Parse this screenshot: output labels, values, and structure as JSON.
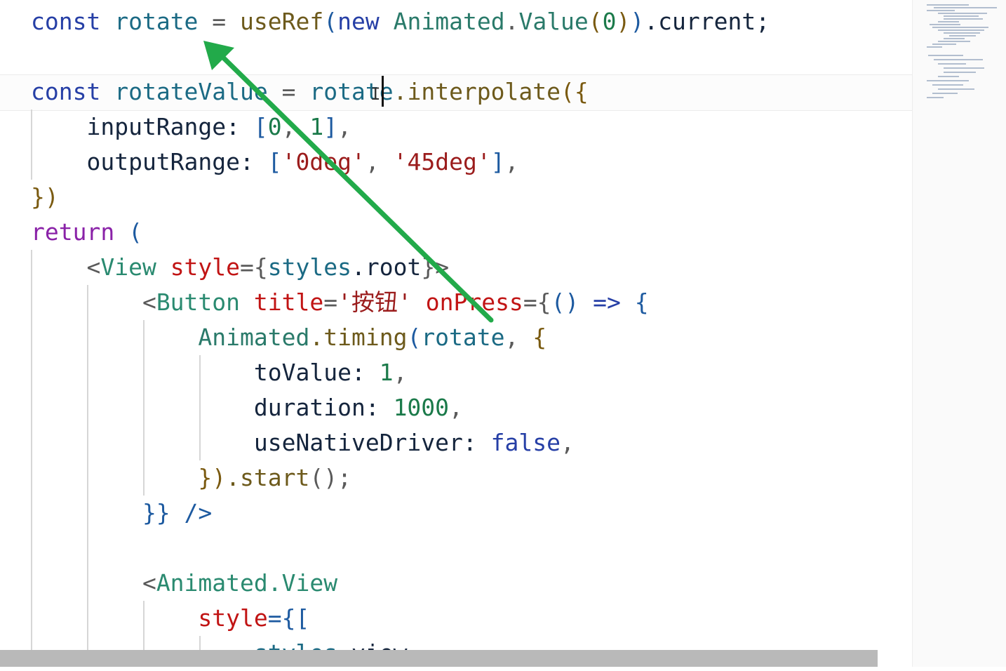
{
  "editor": {
    "lines": [
      [
        [
          "const ",
          "kw"
        ],
        [
          "rotate",
          "var"
        ],
        [
          " = ",
          "pun"
        ],
        [
          "useRef",
          "fn"
        ],
        [
          "(",
          "br1"
        ],
        [
          "new ",
          "kw"
        ],
        [
          "Animated",
          "cls"
        ],
        [
          ".",
          "pun"
        ],
        [
          "Value",
          "cls"
        ],
        [
          "(",
          "br2"
        ],
        [
          "0",
          "num"
        ],
        [
          ")",
          "br2"
        ],
        [
          ")",
          "br1"
        ],
        [
          ".current;",
          "prop"
        ]
      ],
      [],
      [
        [
          "const ",
          "kw"
        ],
        [
          "rotateValue",
          "var"
        ],
        [
          " = ",
          "pun"
        ],
        [
          "rotate",
          "var"
        ],
        [
          ".interpolate",
          "fn"
        ],
        [
          "({",
          "br2"
        ]
      ],
      [
        [
          "    inputRange: ",
          "prop"
        ],
        [
          "[",
          "br1"
        ],
        [
          "0",
          "num"
        ],
        [
          ", ",
          "pun"
        ],
        [
          "1",
          "num"
        ],
        [
          "]",
          "br1"
        ],
        [
          ",",
          "pun"
        ]
      ],
      [
        [
          "    outputRange: ",
          "prop"
        ],
        [
          "[",
          "br1"
        ],
        [
          "'0deg'",
          "str"
        ],
        [
          ", ",
          "pun"
        ],
        [
          "'45deg'",
          "str"
        ],
        [
          "]",
          "br1"
        ],
        [
          ",",
          "pun"
        ]
      ],
      [
        [
          "})",
          "br2"
        ]
      ],
      [
        [
          "return ",
          "kw2"
        ],
        [
          "(",
          "br1"
        ]
      ],
      [
        [
          "    <",
          "pun"
        ],
        [
          "View ",
          "tag"
        ],
        [
          "style",
          "attr"
        ],
        [
          "={",
          "pun"
        ],
        [
          "styles",
          "var"
        ],
        [
          ".root",
          "prop"
        ],
        [
          "}>",
          "pun"
        ]
      ],
      [
        [
          "        <",
          "pun"
        ],
        [
          "Button ",
          "tag"
        ],
        [
          "title",
          "attr"
        ],
        [
          "=",
          "pun"
        ],
        [
          "'按钮'",
          "str"
        ],
        [
          " onPress",
          "attr"
        ],
        [
          "={",
          "pun"
        ],
        [
          "()",
          "br1"
        ],
        [
          " => ",
          "kw"
        ],
        [
          "{",
          "br1"
        ]
      ],
      [
        [
          "            Animated",
          "cls"
        ],
        [
          ".timing",
          "fn"
        ],
        [
          "(",
          "br1"
        ],
        [
          "rotate",
          "var"
        ],
        [
          ", ",
          "pun"
        ],
        [
          "{",
          "br2"
        ]
      ],
      [
        [
          "                toValue: ",
          "prop"
        ],
        [
          "1",
          "num"
        ],
        [
          ",",
          "pun"
        ]
      ],
      [
        [
          "                duration: ",
          "prop"
        ],
        [
          "1000",
          "num"
        ],
        [
          ",",
          "pun"
        ]
      ],
      [
        [
          "                useNativeDriver: ",
          "prop"
        ],
        [
          "false",
          "kw"
        ],
        [
          ",",
          "pun"
        ]
      ],
      [
        [
          "            })",
          "br2"
        ],
        [
          ".start",
          "fn"
        ],
        [
          "();",
          "pun"
        ]
      ],
      [
        [
          "        }} />",
          "br1"
        ]
      ],
      [],
      [
        [
          "        <",
          "pun"
        ],
        [
          "Animated.View",
          "tag"
        ]
      ],
      [
        [
          "            style",
          "attr"
        ],
        [
          "={[",
          "br1"
        ]
      ],
      [
        [
          "                styles",
          "var"
        ],
        [
          ".view,",
          "prop"
        ]
      ]
    ]
  },
  "colors": {
    "arrow": "#22aa4a",
    "keyword": "#263fa6",
    "string": "#9b1c1c",
    "number": "#1b7a4a",
    "attribute": "#c11414"
  }
}
